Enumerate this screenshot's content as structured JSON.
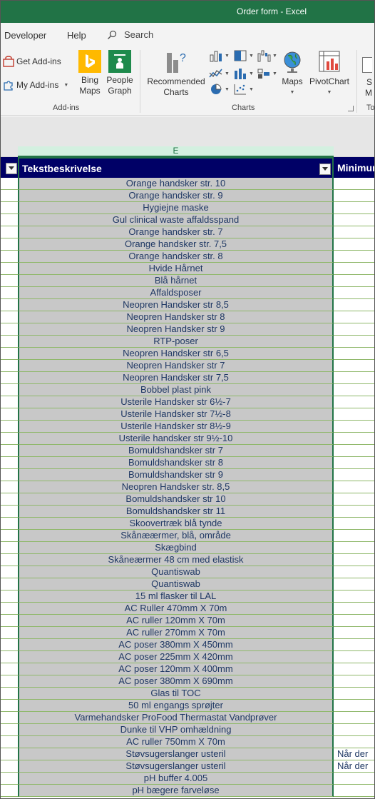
{
  "window": {
    "title": "Order form  -  Excel"
  },
  "tabs": [
    {
      "label": "Developer"
    },
    {
      "label": "Help"
    }
  ],
  "search": {
    "label": "Search"
  },
  "ribbon": {
    "addins": {
      "get_addins": "Get Add-ins",
      "my_addins": "My Add-ins",
      "bing_maps_1": "Bing",
      "bing_maps_2": "Maps",
      "people_graph_1": "People",
      "people_graph_2": "Graph",
      "group_label": "Add-ins"
    },
    "charts": {
      "recommended_1": "Recommended",
      "recommended_2": "Charts",
      "maps": "Maps",
      "pivotchart": "PivotChart",
      "group_label": "Charts"
    },
    "next_group": {
      "partial_1": "S",
      "partial_2": "M",
      "partial_label": "To"
    }
  },
  "sheet": {
    "column_letter": "E",
    "header_e": "Tekstbeskrivelse",
    "header_f": "Minimum",
    "rows": [
      {
        "e": "Orange handsker str. 10",
        "f": ""
      },
      {
        "e": "Orange handsker str. 9",
        "f": ""
      },
      {
        "e": "Hygiejne maske",
        "f": ""
      },
      {
        "e": "Gul clinical waste affaldsspand",
        "f": ""
      },
      {
        "e": "Orange handsker str. 7",
        "f": ""
      },
      {
        "e": "Orange handsker str. 7,5",
        "f": ""
      },
      {
        "e": "Orange handsker str. 8",
        "f": ""
      },
      {
        "e": "Hvide Hårnet",
        "f": ""
      },
      {
        "e": "Blå hårnet",
        "f": ""
      },
      {
        "e": "Affaldsposer",
        "f": ""
      },
      {
        "e": "Neopren Handsker str 8,5",
        "f": ""
      },
      {
        "e": "Neopren Handsker str 8",
        "f": ""
      },
      {
        "e": "Neopren Handsker str 9",
        "f": ""
      },
      {
        "e": "RTP-poser",
        "f": ""
      },
      {
        "e": "Neopren Handsker str 6,5",
        "f": ""
      },
      {
        "e": "Neopren Handsker str 7",
        "f": ""
      },
      {
        "e": "Neopren Handsker str 7,5",
        "f": ""
      },
      {
        "e": "Bobbel plast pink",
        "f": ""
      },
      {
        "e": "Usterile Handsker str 6½-7",
        "f": ""
      },
      {
        "e": "Usterile Handsker str 7½-8",
        "f": ""
      },
      {
        "e": "Usterile Handsker str 8½-9",
        "f": ""
      },
      {
        "e": "Usterile handsker str 9½-10",
        "f": ""
      },
      {
        "e": "Bomuldshandsker str 7",
        "f": ""
      },
      {
        "e": "Bomuldshandsker str 8",
        "f": ""
      },
      {
        "e": "Bomuldshandsker str 9",
        "f": ""
      },
      {
        "e": "Neopren Handsker str. 8,5",
        "f": ""
      },
      {
        "e": "Bomuldshandsker str 10",
        "f": ""
      },
      {
        "e": "Bomuldshandsker str 11",
        "f": ""
      },
      {
        "e": "Skoovertræk blå tynde",
        "f": ""
      },
      {
        "e": "Skånæærmer, blå, område",
        "f": ""
      },
      {
        "e": "Skægbind",
        "f": ""
      },
      {
        "e": "Skåneærmer 48 cm med elastisk",
        "f": ""
      },
      {
        "e": "Quantiswab",
        "f": ""
      },
      {
        "e": "Quantiswab",
        "f": ""
      },
      {
        "e": "15 ml flasker til LAL",
        "f": ""
      },
      {
        "e": "AC Ruller 470mm X 70m",
        "f": ""
      },
      {
        "e": "AC ruller 120mm X 70m",
        "f": ""
      },
      {
        "e": "AC ruller 270mm X 70m",
        "f": ""
      },
      {
        "e": "AC poser 380mm X 450mm",
        "f": ""
      },
      {
        "e": "AC poser 225mm X 420mm",
        "f": ""
      },
      {
        "e": "AC poser 120mm X 400mm",
        "f": ""
      },
      {
        "e": "AC poser 380mm X 690mm",
        "f": ""
      },
      {
        "e": "Glas til TOC",
        "f": ""
      },
      {
        "e": "50 ml engangs sprøjter",
        "f": ""
      },
      {
        "e": "Varmehandsker ProFood Thermastat Vandprøver",
        "f": ""
      },
      {
        "e": "Dunke til VHP omhældning",
        "f": ""
      },
      {
        "e": "AC ruller 750mm X 70m",
        "f": ""
      },
      {
        "e": "Støvsugerslanger usteril",
        "f": "Når der"
      },
      {
        "e": "Støvsugerslanger usteril",
        "f": "Når der"
      },
      {
        "e": "pH buffer 4.005",
        "f": ""
      },
      {
        "e": "pH bægere farveløse",
        "f": ""
      }
    ]
  },
  "colors": {
    "excel_green": "#217346",
    "header_navy": "#000066",
    "cell_gray": "#c8c8c8",
    "text_navy": "#1f3864",
    "gridline_green": "#8fb86a"
  }
}
